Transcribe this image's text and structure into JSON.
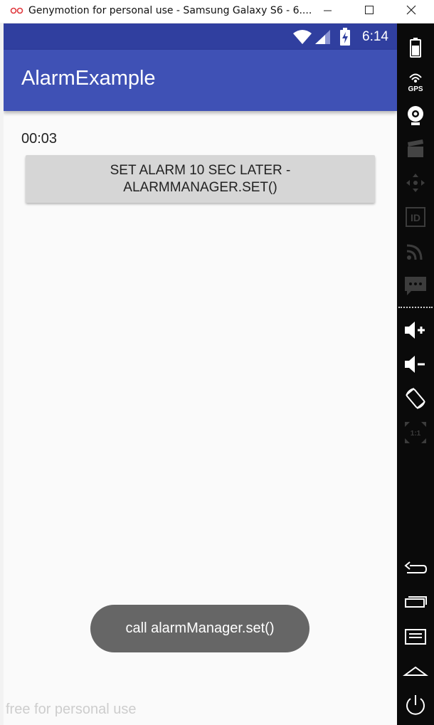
{
  "window": {
    "title": "Genymotion for personal use - Samsung Galaxy S6 - 6....",
    "watermark": "free for personal use"
  },
  "status_bar": {
    "time": "6:14",
    "icons": [
      "wifi-icon",
      "cell-signal-icon",
      "battery-charging-icon"
    ]
  },
  "app": {
    "title": "AlarmExample",
    "elapsed": "00:03",
    "button_label": "SET ALARM 10 SEC LATER - ALARMMANAGER.SET()",
    "toast": "call alarmManager.set()"
  },
  "toolbar": {
    "top_icons": [
      "battery-icon",
      "gps-icon",
      "webcam-icon",
      "clapperboard-icon",
      "dpad-icon",
      "id-icon",
      "rss-icon",
      "sms-icon"
    ],
    "bottom_icons": [
      "volume-up-icon",
      "volume-down-icon",
      "rotate-icon",
      "scale-icon",
      "back-icon",
      "recent-apps-icon",
      "menu-icon",
      "home-icon",
      "power-icon"
    ],
    "gps_label": "GPS",
    "id_label": "ID",
    "scale_label": "1:1"
  },
  "colors": {
    "status_bar": "#303F9F",
    "app_bar": "#3F51B5",
    "screen_bg": "#FAFAFA",
    "button_bg": "#D6D6D6",
    "toast_bg": "#666666",
    "toolbar_bg": "#0A0A0A"
  }
}
